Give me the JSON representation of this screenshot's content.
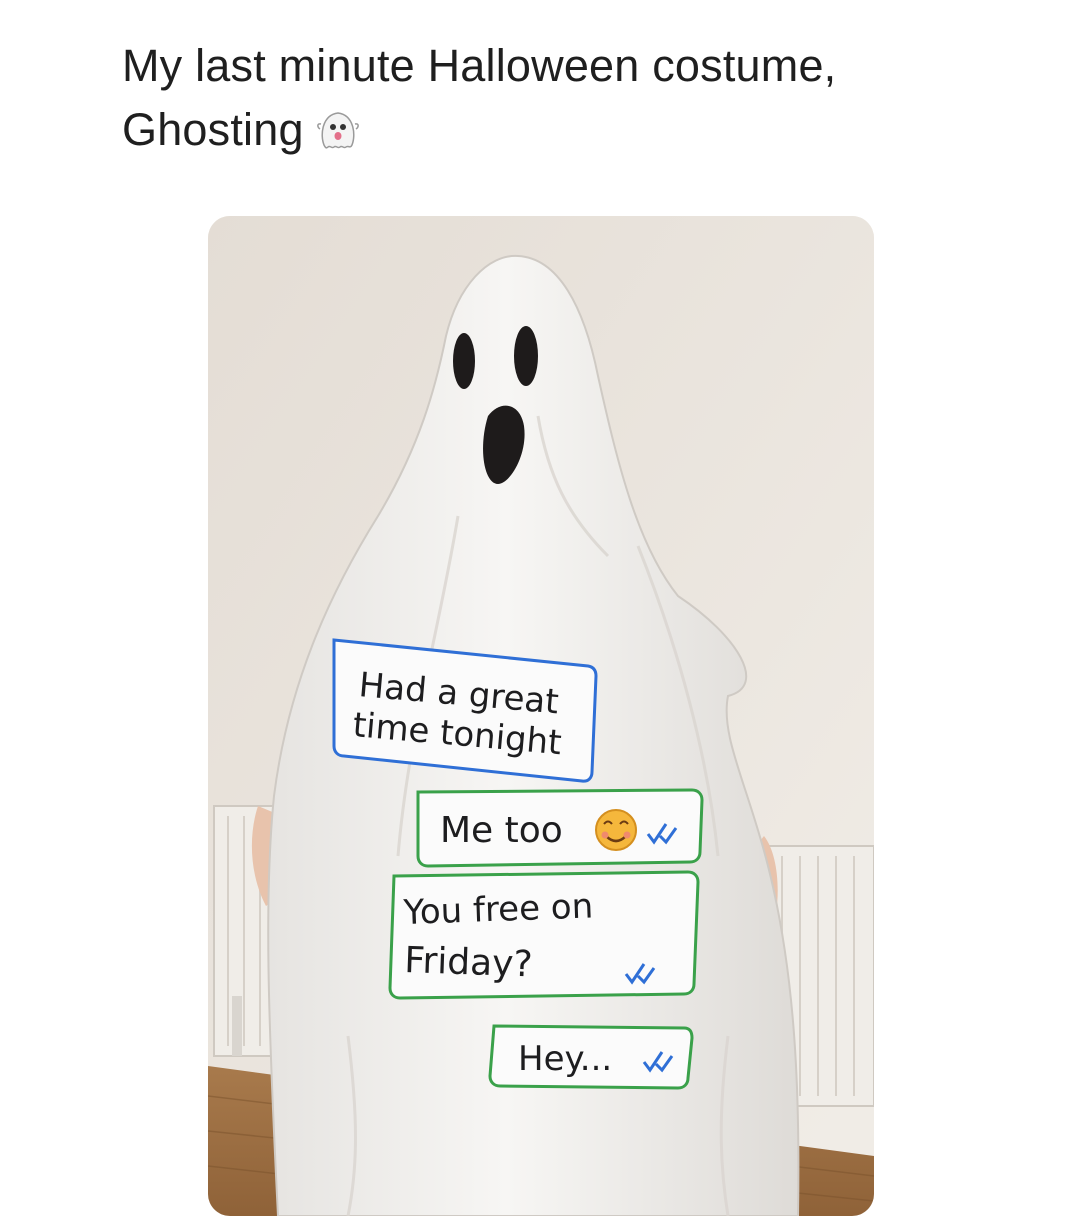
{
  "post": {
    "line1": "My last minute Halloween costume,",
    "line2": "Ghosting",
    "emoji": "ghost-emoji"
  },
  "photo": {
    "messages": [
      {
        "line1": "Had a great",
        "line2": "time tonight",
        "color": "#2f6fd6",
        "status": ""
      },
      {
        "line1": "Me too",
        "line2": "",
        "color": "#3aa14a",
        "status": "check-icon",
        "emoji": "smiling-face-emoji"
      },
      {
        "line1": "You free on",
        "line2": "Friday?",
        "color": "#3aa14a",
        "status": "check-icon"
      },
      {
        "line1": "Hey...",
        "line2": "",
        "color": "#3aa14a",
        "status": "check-icon"
      }
    ]
  }
}
